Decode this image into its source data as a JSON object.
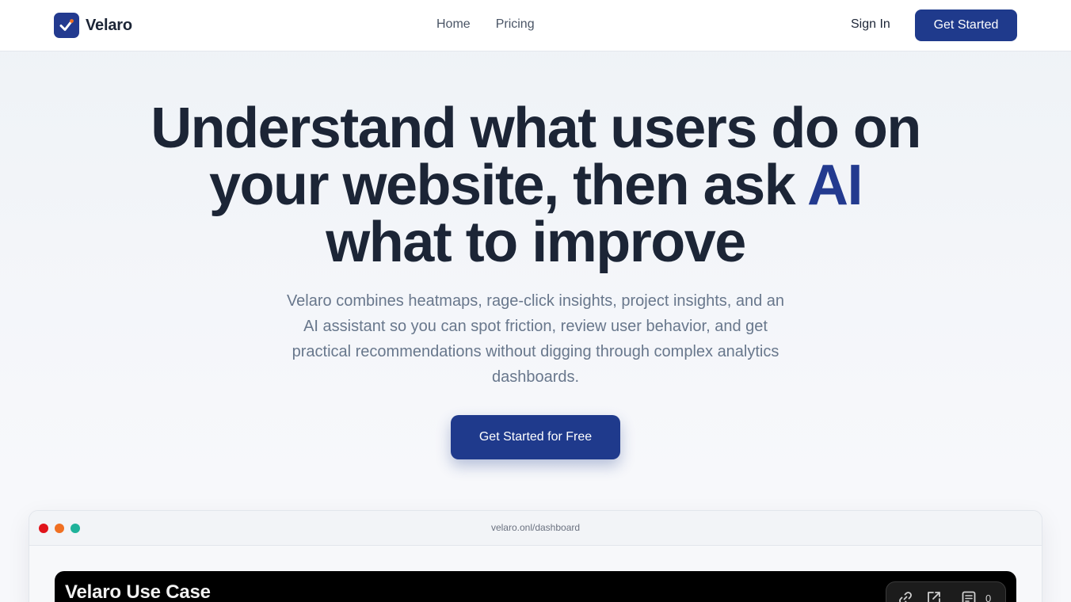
{
  "header": {
    "logo_text": "Velaro",
    "nav": [
      {
        "label": "Home"
      },
      {
        "label": "Pricing"
      }
    ],
    "sign_in": "Sign In",
    "get_started": "Get Started"
  },
  "hero": {
    "title_part1": "Understand what users do on your website, then ask ",
    "title_accent": "AI",
    "title_part2": " what to improve",
    "subtitle": "Velaro combines heatmaps, rage-click insights, project insights, and an AI assistant so you can spot friction, review user behavior, and get practical recommendations without digging through complex analytics dashboards.",
    "cta": "Get Started for Free"
  },
  "preview": {
    "url": "velaro.onl/dashboard",
    "video_title": "Velaro Use Case",
    "comment_count": "0"
  },
  "colors": {
    "brand": "#1f3a8c",
    "heading": "#1c2536",
    "muted": "#68778c",
    "traffic_red": "#e0141b",
    "traffic_orange": "#f07022",
    "traffic_teal": "#1fb29a"
  },
  "icons": [
    "logo-check-icon",
    "link-icon",
    "external-link-icon",
    "comment-icon"
  ]
}
